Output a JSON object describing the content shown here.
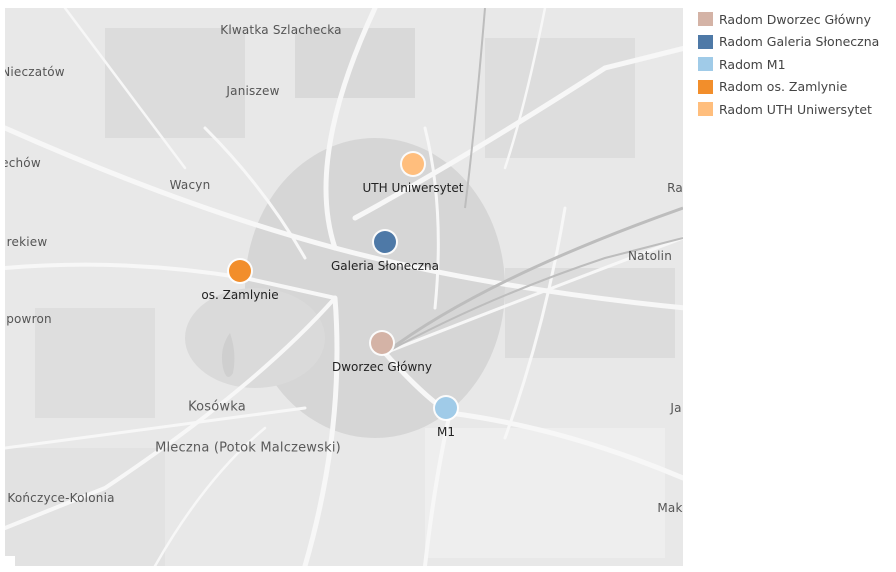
{
  "legend": [
    {
      "name": "Radom Dworzec Główny",
      "color": "#d4b3a6"
    },
    {
      "name": "Radom Galeria Słoneczna",
      "color": "#4e79a7"
    },
    {
      "name": "Radom M1",
      "color": "#a0cbe8"
    },
    {
      "name": "Radom os. Zamlynie",
      "color": "#f28e2b"
    },
    {
      "name": "Radom UTH Uniwersytet",
      "color": "#ffbe7d"
    }
  ],
  "markers": [
    {
      "series": "Radom Dworzec Główny",
      "label": "Dworzec Główny",
      "color": "#d4b3a6"
    },
    {
      "series": "Radom Galeria Słoneczna",
      "label": "Galeria Słoneczna",
      "color": "#4e79a7"
    },
    {
      "series": "Radom M1",
      "label": "M1",
      "color": "#a0cbe8"
    },
    {
      "series": "Radom os. Zamlynie",
      "label": "os. Zamlynie",
      "color": "#f28e2b"
    },
    {
      "series": "Radom UTH Uniwersytet",
      "label": "UTH Uniwersytet",
      "color": "#ffbe7d"
    }
  ],
  "places": [
    {
      "text": "Klwatka Szlachecka"
    },
    {
      "text": "Nieczatów"
    },
    {
      "text": "Janiszew"
    },
    {
      "text": "echów"
    },
    {
      "text": "Wacyn"
    },
    {
      "text": "rekiew"
    },
    {
      "text": "powron"
    },
    {
      "text": "Natolin"
    },
    {
      "text": "Ra"
    },
    {
      "text": "Ja"
    },
    {
      "text": "Kosówka"
    },
    {
      "text": "Mleczna (Potok Malczewski)"
    },
    {
      "text": "Kończyce-Kolonia"
    },
    {
      "text": "Mak"
    }
  ]
}
